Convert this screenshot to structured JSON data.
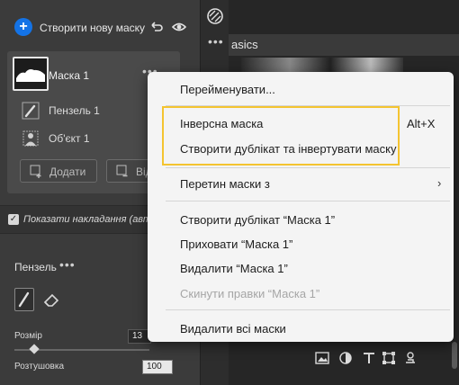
{
  "masks_panel": {
    "create_label": "Створити нову маску",
    "mask_name": "Маска 1",
    "sub_items": [
      {
        "label": "Пензель 1",
        "icon": "brush-icon"
      },
      {
        "label": "Об'єкт 1",
        "icon": "person-icon"
      }
    ],
    "add_label": "Додати",
    "subtract_label": "Відня",
    "overlay_label": "Показати накладання (авто)",
    "overlay_checked": true
  },
  "brush": {
    "title": "Пензель",
    "size_label": "Розмір",
    "size_value": "13",
    "feather_label": "Розтушовка",
    "feather_value": "100"
  },
  "right_panel": {
    "basics_text": "asics"
  },
  "context_menu": {
    "items": [
      {
        "label": "Перейменувати...",
        "disabled": false
      },
      {
        "label": "Інверсна маска",
        "disabled": false,
        "shortcut": "Alt+X"
      },
      {
        "label": "Створити дублікат та інвертувати маску",
        "disabled": false
      },
      {
        "label": "Перетин маски з",
        "disabled": false,
        "submenu": true
      },
      {
        "label": "Створити дублікат “Маска 1”",
        "disabled": false
      },
      {
        "label": "Приховати “Маска 1”",
        "disabled": false
      },
      {
        "label": "Видалити “Маска 1”",
        "disabled": false
      },
      {
        "label": "Скинути правки “Маска 1”",
        "disabled": true
      },
      {
        "label": "Видалити всі маски",
        "disabled": false
      }
    ],
    "shortcut": "Alt+X",
    "submenu_arrow": "›",
    "highlight_color": "#f4c430"
  },
  "colors": {
    "accent": "#1473e6"
  }
}
